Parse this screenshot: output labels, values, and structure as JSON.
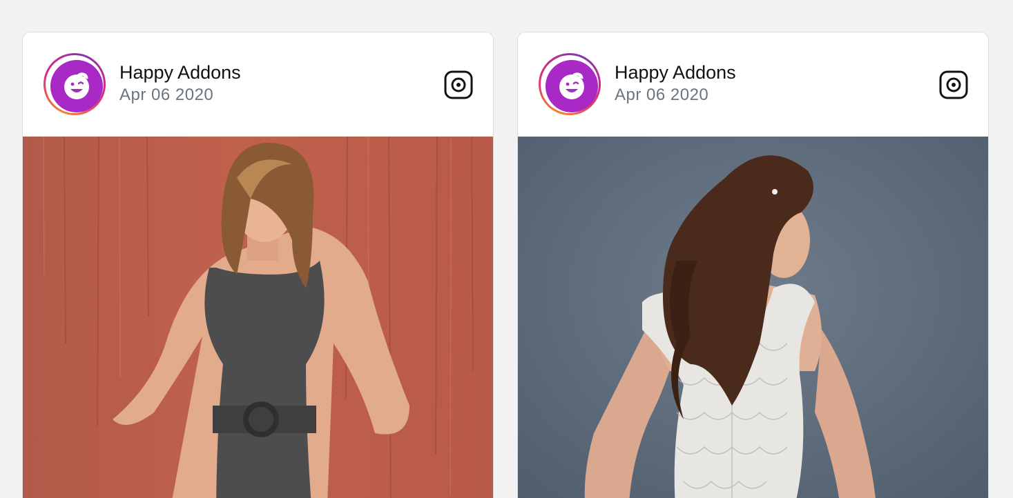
{
  "colors": {
    "page_background": "#f2f2f2",
    "card_background": "#ffffff",
    "avatar_purple": "#a829c6",
    "ring_gradient": [
      "#f58529",
      "#dd2a7b",
      "#8134af"
    ],
    "date_text": "#6b7480"
  },
  "posts": [
    {
      "author": "Happy Addons",
      "date": "Apr 06 2020",
      "avatar_icon": "happy-face-icon",
      "platform_icon": "instagram-icon",
      "photo": "woman in grey sleeveless dress against rusty red wall"
    },
    {
      "author": "Happy Addons",
      "date": "Apr 06 2020",
      "avatar_icon": "happy-face-icon",
      "platform_icon": "instagram-icon",
      "photo": "woman in white lace corset gown against blue-grey backdrop"
    }
  ]
}
